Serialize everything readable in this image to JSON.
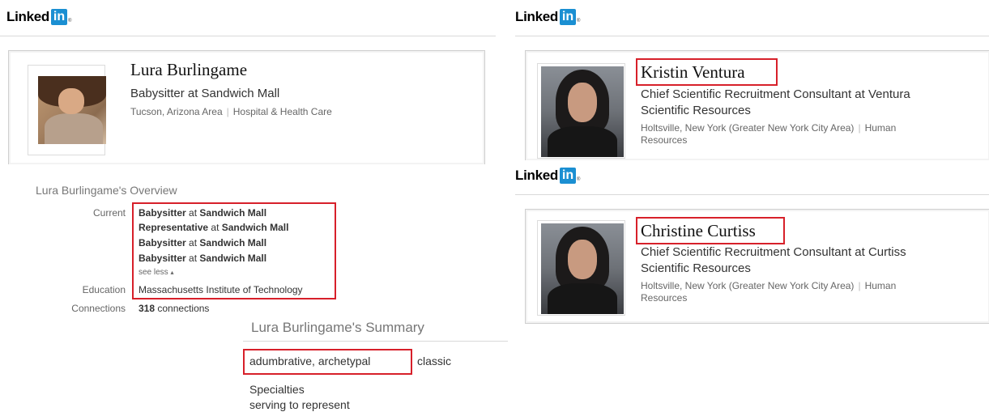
{
  "logo": {
    "word": "Linked",
    "in": "in",
    "reg": "®"
  },
  "left_profile": {
    "name": "Lura Burlingame",
    "headline": "Babysitter at Sandwich Mall",
    "location": "Tucson, Arizona Area",
    "industry": "Hospital & Health Care"
  },
  "overview": {
    "title": "Lura Burlingame's Overview",
    "current_label": "Current",
    "current": [
      {
        "role": "Babysitter",
        "at": "at",
        "company": "Sandwich Mall"
      },
      {
        "role": "Representative",
        "at": "at",
        "company": "Sandwich Mall"
      },
      {
        "role": "Babysitter",
        "at": "at",
        "company": "Sandwich Mall"
      },
      {
        "role": "Babysitter",
        "at": "at",
        "company": "Sandwich Mall"
      }
    ],
    "see_less": "see less",
    "education_label": "Education",
    "education": "Massachusetts Institute of Technology",
    "connections_label": "Connections",
    "connections_count": "318",
    "connections_word": "connections"
  },
  "summary": {
    "title": "Lura Burlingame's Summary",
    "highlighted": "adumbrative, archetypal",
    "rest": "classic",
    "specialties_label": "Specialties",
    "specialties": "serving to represent"
  },
  "right_profiles": [
    {
      "name": "Kristin Ventura",
      "headline_l1": "Chief Scientific Recruitment Consultant at Ventura",
      "headline_l2": "Scientific Resources",
      "location": "Holtsville, New York (Greater New York City Area)",
      "industry_l1": "Human",
      "industry_l2": "Resources"
    },
    {
      "name": "Christine Curtiss",
      "headline_l1": "Chief Scientific Recruitment Consultant at Curtiss",
      "headline_l2": "Scientific Resources",
      "location": "Holtsville, New York (Greater New York City Area)",
      "industry_l1": "Human",
      "industry_l2": "Resources"
    }
  ],
  "colors": {
    "highlight_red": "#d7202a",
    "linkedin_blue": "#1b8fd2"
  }
}
